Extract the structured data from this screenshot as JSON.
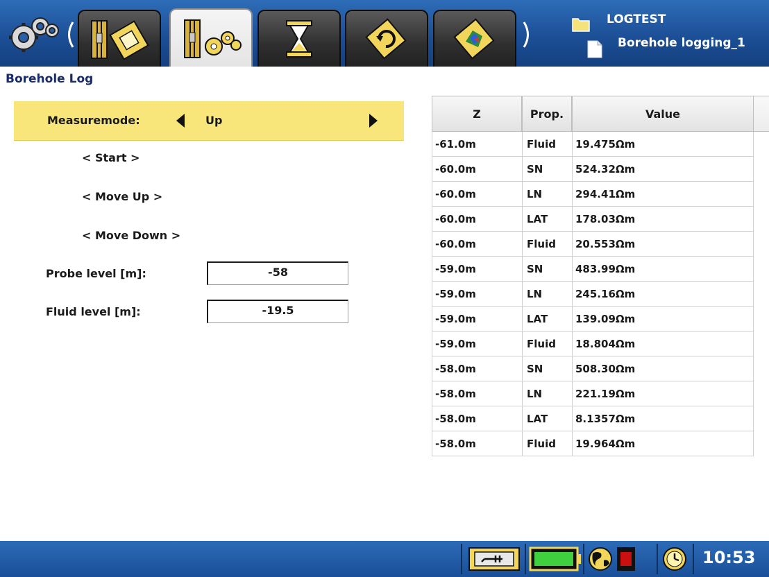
{
  "header": {
    "tabs": [
      {
        "icon": "borehole-sheet-icon",
        "active": false
      },
      {
        "icon": "borehole-settings-icon",
        "active": true
      },
      {
        "icon": "hourglass-icon",
        "active": false
      },
      {
        "icon": "refresh-tag-icon",
        "active": false
      },
      {
        "icon": "color-map-tag-icon",
        "active": false
      }
    ],
    "project_name": "LOGTEST",
    "document_name": "Borehole logging_1"
  },
  "page_title": "Borehole Log",
  "measure": {
    "label": "Measuremode:",
    "value": "Up"
  },
  "actions": {
    "start": "< Start >",
    "move_up": "< Move Up >",
    "move_down": "< Move Down >"
  },
  "fields": {
    "probe_label": "Probe level [m]:",
    "probe_value": "-58",
    "fluid_label": "Fluid level [m]:",
    "fluid_value": "-19.5"
  },
  "table": {
    "headers": [
      "Z",
      "Prop.",
      "Value"
    ],
    "rows": [
      {
        "z": "-61.0m",
        "prop": "Fluid",
        "value": "19.475Ωm"
      },
      {
        "z": "-60.0m",
        "prop": "SN",
        "value": "524.32Ωm"
      },
      {
        "z": "-60.0m",
        "prop": "LN",
        "value": "294.41Ωm"
      },
      {
        "z": "-60.0m",
        "prop": "LAT",
        "value": "178.03Ωm"
      },
      {
        "z": "-60.0m",
        "prop": "Fluid",
        "value": "20.553Ωm"
      },
      {
        "z": "-59.0m",
        "prop": "SN",
        "value": "483.99Ωm"
      },
      {
        "z": "-59.0m",
        "prop": "LN",
        "value": "245.16Ωm"
      },
      {
        "z": "-59.0m",
        "prop": "LAT",
        "value": "139.09Ωm"
      },
      {
        "z": "-59.0m",
        "prop": "Fluid",
        "value": "18.804Ωm"
      },
      {
        "z": "-58.0m",
        "prop": "SN",
        "value": "508.30Ωm"
      },
      {
        "z": "-58.0m",
        "prop": "LN",
        "value": "221.19Ωm"
      },
      {
        "z": "-58.0m",
        "prop": "LAT",
        "value": "8.1357Ωm"
      },
      {
        "z": "-58.0m",
        "prop": "Fluid",
        "value": "19.964Ωm"
      }
    ]
  },
  "status": {
    "clock": "10:53",
    "colors": {
      "accent": "#f8e67a",
      "bar": "#1c4f96",
      "battery": "#3fcf3f",
      "record": "#cc1010"
    }
  }
}
